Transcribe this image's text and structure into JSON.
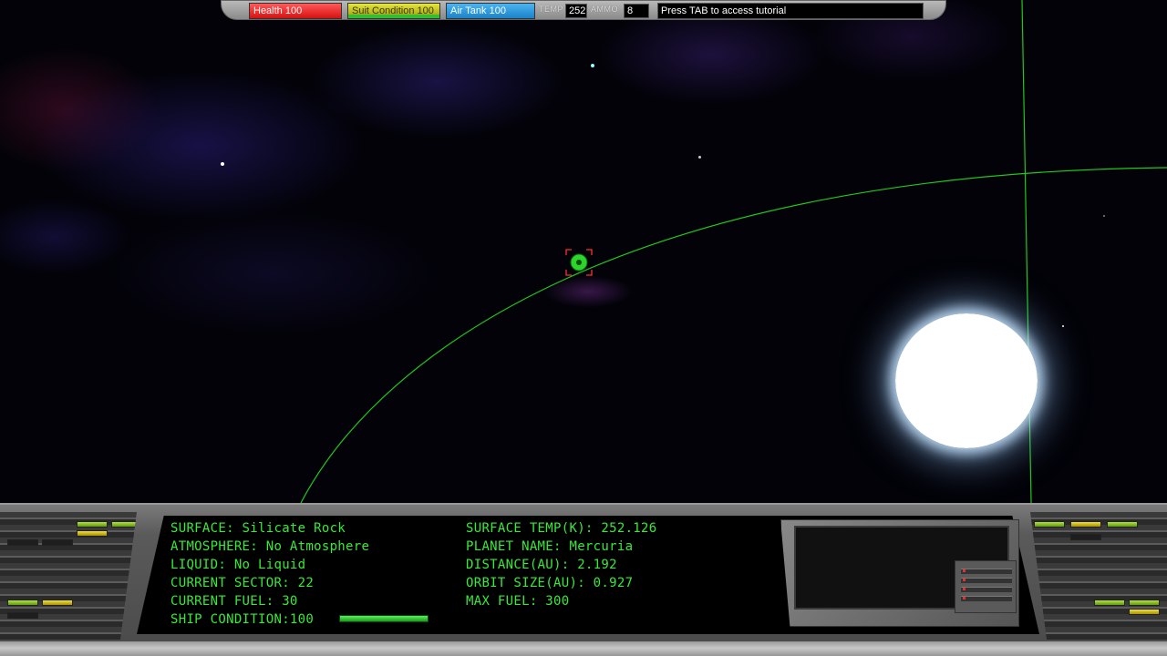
{
  "hud": {
    "health": {
      "label": "Health 100",
      "value": 100,
      "color": "#e01818"
    },
    "suit_condition": {
      "label": "Suit Condition 100",
      "value": 100,
      "color": "#c8c820"
    },
    "air_tank": {
      "label": "Air Tank 100",
      "value": 100,
      "color": "#2894dc"
    },
    "temp": {
      "label": "TEMP",
      "value": "252"
    },
    "ammo": {
      "label": "AMMO",
      "value": "8"
    },
    "message": "Press TAB to access tutorial"
  },
  "readout": {
    "surface": "SURFACE: Silicate Rock",
    "atmosphere": "ATMOSPHERE: No Atmosphere",
    "liquid": "LIQUID: No Liquid",
    "current_sector": "CURRENT SECTOR: 22",
    "current_fuel": "CURRENT FUEL: 30",
    "ship_condition": "SHIP CONDITION:100",
    "ship_condition_value": 1.0,
    "surface_temp": "SURFACE TEMP(K): 252.126",
    "planet_name": "PLANET NAME: Mercuria",
    "distance": "DISTANCE(AU): 2.192",
    "orbit_size": "ORBIT SIZE(AU): 0.927",
    "max_fuel": "MAX FUEL: 300",
    "text_color": "#39e83a"
  },
  "scene": {
    "orbit_color": "#1fc81f",
    "target_marker_color": "#ff3030",
    "planet_color": "#2cd42c",
    "sun_color": "#ffffff"
  }
}
